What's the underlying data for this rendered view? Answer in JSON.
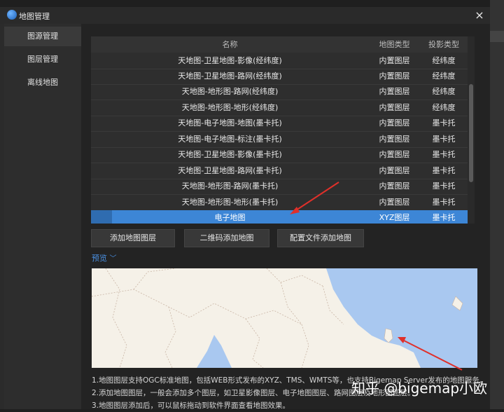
{
  "window": {
    "title": "地图管理",
    "close": "×"
  },
  "sidebar": {
    "items": [
      {
        "label": "图源管理",
        "active": true
      },
      {
        "label": "图层管理",
        "active": false
      },
      {
        "label": "离线地图",
        "active": false
      }
    ]
  },
  "table": {
    "columns": [
      "名称",
      "地图类型",
      "投影类型"
    ],
    "rows": [
      [
        "天地图-卫星地图-影像(经纬度)",
        "内置图层",
        "经纬度"
      ],
      [
        "天地图-卫星地图-路网(经纬度)",
        "内置图层",
        "经纬度"
      ],
      [
        "天地图-地形图-路网(经纬度)",
        "内置图层",
        "经纬度"
      ],
      [
        "天地图-地形图-地形(经纬度)",
        "内置图层",
        "经纬度"
      ],
      [
        "天地图-电子地图-地图(墨卡托)",
        "内置图层",
        "墨卡托"
      ],
      [
        "天地图-电子地图-标注(墨卡托)",
        "内置图层",
        "墨卡托"
      ],
      [
        "天地图-卫星地图-影像(墨卡托)",
        "内置图层",
        "墨卡托"
      ],
      [
        "天地图-卫星地图-路网(墨卡托)",
        "内置图层",
        "墨卡托"
      ],
      [
        "天地图-地形图-路网(墨卡托)",
        "内置图层",
        "墨卡托"
      ],
      [
        "天地图-地形图-地形(墨卡托)",
        "内置图层",
        "墨卡托"
      ],
      [
        "电子地图",
        "XYZ图层",
        "墨卡托"
      ]
    ],
    "selected_row": 10
  },
  "buttons": {
    "add_layer": "添加地图图层",
    "qr_add": "二维码添加地图",
    "config_add": "配置文件添加地图"
  },
  "preview": {
    "label": "预览",
    "chevron": "chevron-down-icon"
  },
  "notes": [
    "1.地图图层支持OGC标准地图，包括WEB形式发布的XYZ、TMS、WMTS等，也支持Bigemap Server发布的地图服务。",
    "2.添加地图图层，一般会添加多个图层，如卫星影像图层、电子地图图层、路网图层及地形图图层。",
    "3.地图图层添加后，可以鼠标拖动到软件界面查看地图效果。"
  ],
  "watermark": "知乎 @bigemap小欧",
  "colors": {
    "accent": "#3d86d6",
    "link": "#4a90e2",
    "annotation": "#e0302a",
    "sea": "#a9c8f0",
    "land": "#f5f1e8"
  }
}
